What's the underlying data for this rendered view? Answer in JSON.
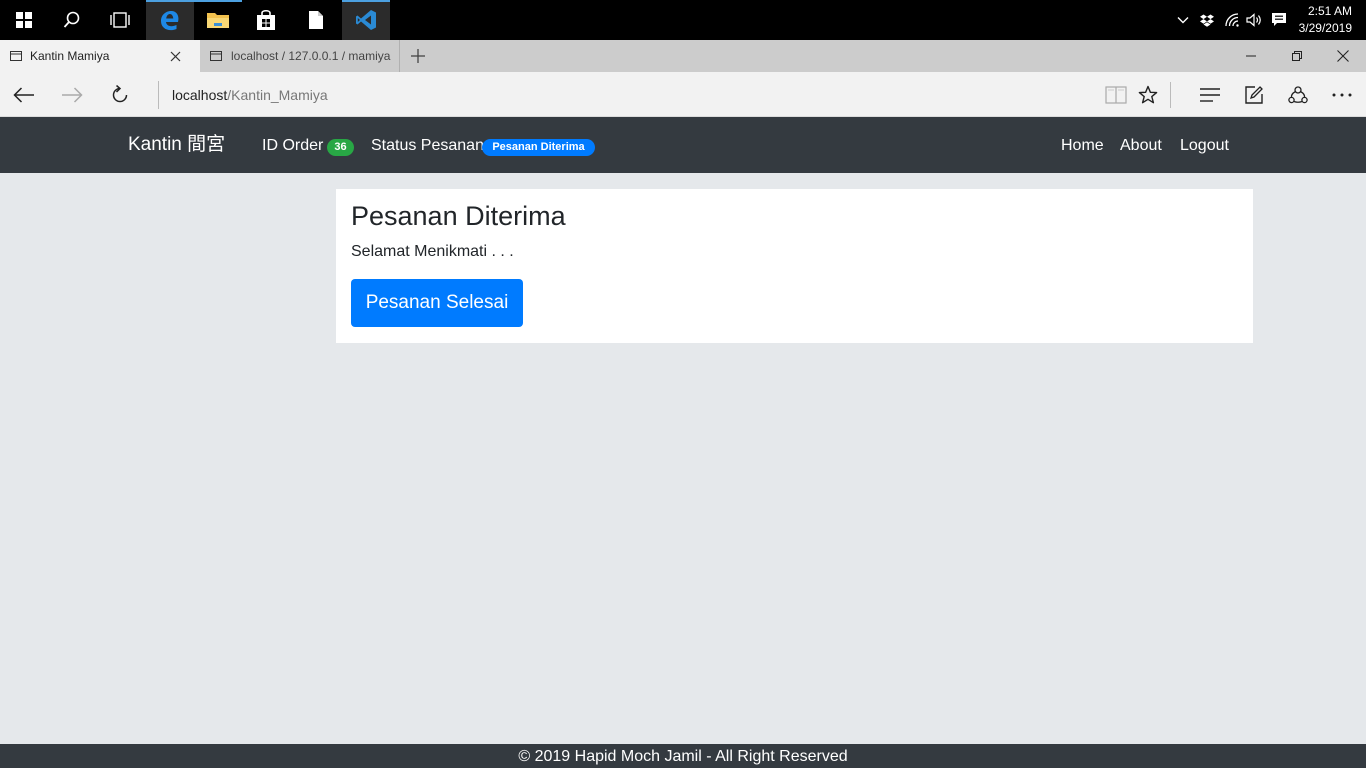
{
  "taskbar": {
    "items": [
      {
        "name": "start",
        "icon": "windows-icon"
      },
      {
        "name": "search",
        "icon": "search-icon"
      },
      {
        "name": "task-view",
        "icon": "task-view-icon"
      },
      {
        "name": "edge",
        "icon": "edge-browser-icon"
      },
      {
        "name": "file-explorer",
        "icon": "folder-icon"
      },
      {
        "name": "store",
        "icon": "store-bag-icon"
      },
      {
        "name": "file",
        "icon": "document-icon"
      },
      {
        "name": "vscode",
        "icon": "vscode-icon"
      }
    ],
    "tray_icons": [
      "chevron-up-icon",
      "dropbox-icon",
      "wifi-icon",
      "volume-icon",
      "notification-icon"
    ],
    "time": "2:51 AM",
    "date": "3/29/2019"
  },
  "browser": {
    "tabs": [
      {
        "title": "Kantin Mamiya",
        "active": true
      },
      {
        "title": "localhost / 127.0.0.1 / mamiya",
        "active": false
      }
    ],
    "url_host": "localhost",
    "url_path": "/Kantin_Mamiya",
    "accent_color": "#4ca0e0"
  },
  "navbar": {
    "brand": "Kantin 間宮",
    "id_order_label": "ID Order",
    "id_order_value": "36",
    "status_label": "Status Pesanan",
    "status_value": "Pesanan Diterima",
    "links": [
      "Home",
      "About",
      "Logout"
    ],
    "colors": {
      "background": "#343a40",
      "badge_success": "#28a745",
      "badge_primary": "#007bff"
    }
  },
  "main": {
    "title": "Pesanan Diterima",
    "text": "Selamat Menikmati . . .",
    "button_label": "Pesanan Selesai",
    "button_color": "#007bff"
  },
  "footer": {
    "text": "© 2019 Hapid Moch Jamil - All Right Reserved"
  }
}
